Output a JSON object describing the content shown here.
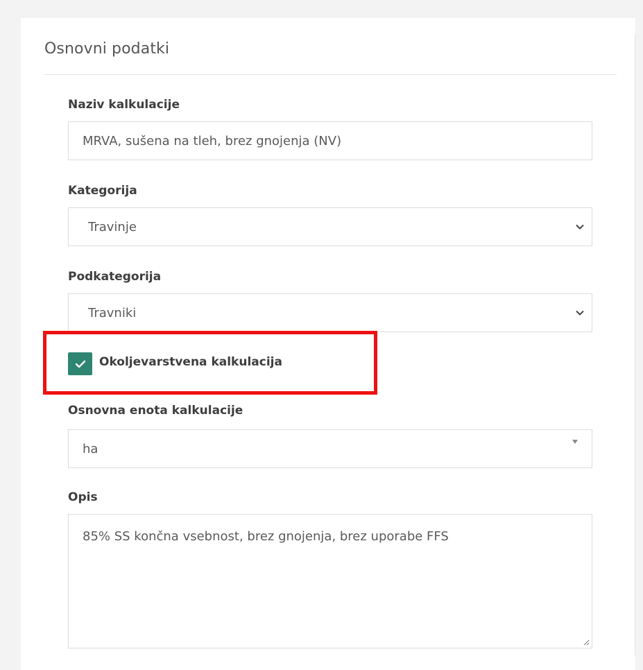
{
  "section": {
    "title": "Osnovni podatki"
  },
  "form": {
    "name": {
      "label": "Naziv kalkulacije",
      "value": "MRVA, sušena na tleh, brez gnojenja (NV)"
    },
    "category": {
      "label": "Kategorija",
      "selected": "Travinje"
    },
    "subcategory": {
      "label": "Podkategorija",
      "selected": "Travniki"
    },
    "environmental": {
      "label": "Okoljevarstvena kalkulacija",
      "checked": true
    },
    "base_unit": {
      "label": "Osnovna enota kalkulacije",
      "selected": "ha"
    },
    "description": {
      "label": "Opis",
      "value": "85% SS končna vsebnost, brez gnojenja, brez uporabe FFS"
    }
  },
  "colors": {
    "accent": "#2e8572",
    "highlight": "#ee1111"
  },
  "icons": {
    "select_arrow": "chevron-down-icon",
    "select2_arrow": "caret-down-icon",
    "checkbox": "check-icon",
    "resize": "resize-handle-icon"
  }
}
